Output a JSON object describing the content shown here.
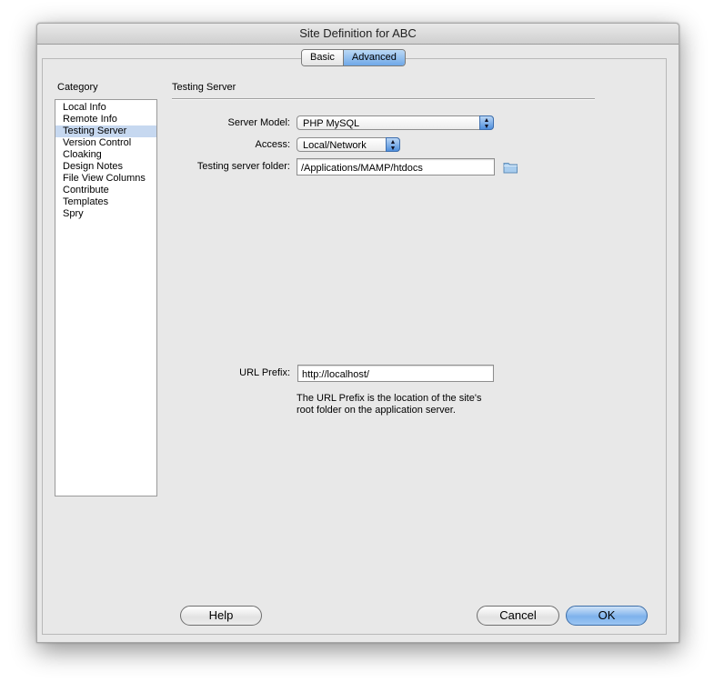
{
  "window": {
    "title": "Site Definition for ABC"
  },
  "tabs": [
    {
      "label": "Basic",
      "active": false
    },
    {
      "label": "Advanced",
      "active": true
    }
  ],
  "category": {
    "label": "Category",
    "items": [
      {
        "label": "Local Info"
      },
      {
        "label": "Remote Info"
      },
      {
        "label": "Testing Server",
        "selected": true
      },
      {
        "label": "Version Control"
      },
      {
        "label": "Cloaking"
      },
      {
        "label": "Design Notes"
      },
      {
        "label": "File View Columns"
      },
      {
        "label": "Contribute"
      },
      {
        "label": "Templates"
      },
      {
        "label": "Spry"
      }
    ]
  },
  "section": {
    "title": "Testing Server"
  },
  "form": {
    "server_model_label": "Server Model:",
    "server_model_value": "PHP MySQL",
    "access_label": "Access:",
    "access_value": "Local/Network",
    "folder_label": "Testing server folder:",
    "folder_value": "/Applications/MAMP/htdocs",
    "url_prefix_label": "URL Prefix:",
    "url_prefix_value": "http://localhost/",
    "url_prefix_help_line1": "The URL Prefix is the location of the site's",
    "url_prefix_help_line2": "root folder on the application server."
  },
  "buttons": {
    "help": "Help",
    "cancel": "Cancel",
    "ok": "OK"
  },
  "colors": {
    "selection": "#c6d8f0",
    "accent": "#7eb2ec"
  }
}
